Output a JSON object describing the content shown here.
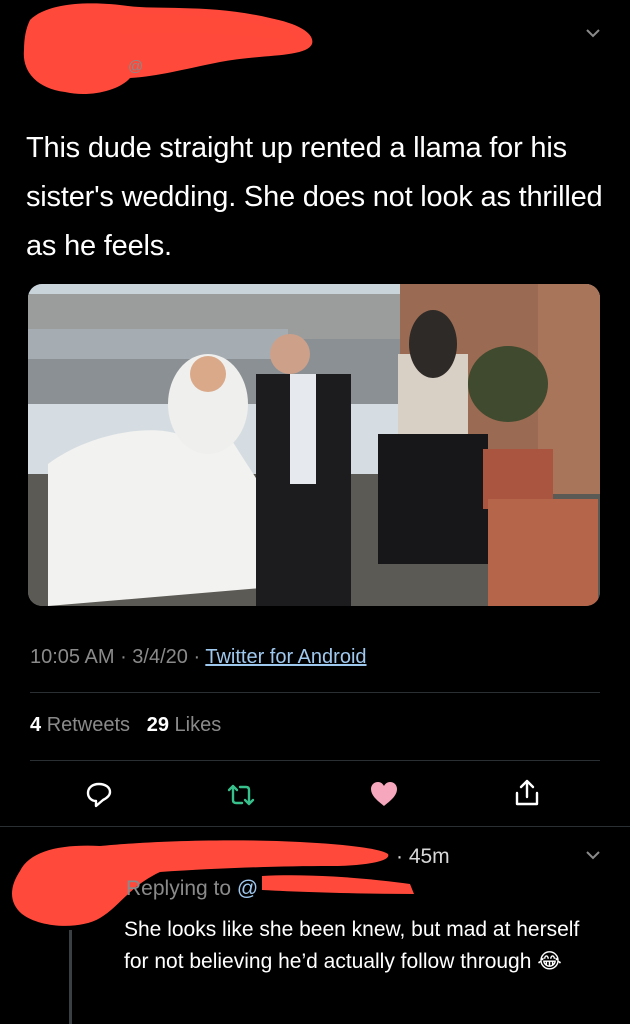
{
  "tweet": {
    "handle_prefix": "@",
    "text": "This dude straight up rented a llama for his sister's wedding.  She does not look as thrilled as he feels.",
    "time": "10:05 AM",
    "date": "3/4/20",
    "source": "Twitter for Android",
    "retweets_count": "4",
    "retweets_label": "Retweets",
    "likes_count": "29",
    "likes_label": "Likes"
  },
  "icons": {
    "reply": "reply-icon",
    "retweet": "retweet-icon",
    "like": "heart-icon",
    "share": "share-icon",
    "menu": "chevron-down-icon"
  },
  "reply": {
    "time": "45m",
    "replying_to_label": "Replying to",
    "replying_to_handle": "@",
    "text": "She looks like she been knew, but mad at herself for not believing he’d actually follow through",
    "emoji": "😂"
  },
  "colors": {
    "background": "#000000",
    "redaction": "#ff4a3b",
    "secondary_text": "#8a8a8a",
    "link": "#9fc8ee",
    "heart": "#f7a7bd",
    "retweet": "#38c08c"
  }
}
